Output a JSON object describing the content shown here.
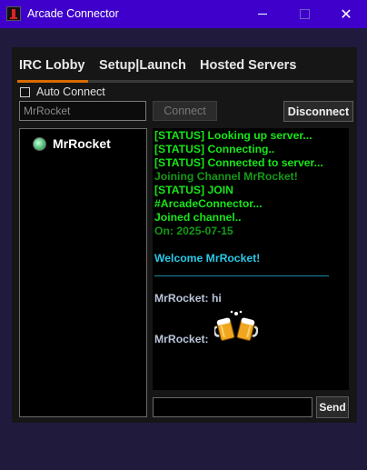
{
  "window": {
    "title": "Arcade Connector",
    "minimize_icon": "minimize-icon",
    "maximize_icon": "maximize-icon",
    "close_icon": "close-icon",
    "close_glyph": "✕"
  },
  "tabs": [
    {
      "label": "IRC Lobby",
      "active": true
    },
    {
      "label": "Setup|Launch",
      "active": false
    },
    {
      "label": "Hosted Servers",
      "active": false
    }
  ],
  "accent_color": "#d96b00",
  "auto_connect": {
    "label": "Auto Connect",
    "checked": false
  },
  "nickname_input": {
    "value": "MrRocket"
  },
  "buttons": {
    "connect": "Connect",
    "disconnect": "Disconnect",
    "send": "Send"
  },
  "users": [
    {
      "name": "MrRocket",
      "status_icon": "online-status-icon"
    }
  ],
  "chat": {
    "lines": [
      "[STATUS] Looking up server...",
      "[STATUS] Connecting..",
      "[STATUS] Connected to server...",
      "Joining Channel MrRocket!",
      "[STATUS] JOIN",
      "#ArcadeConnector...",
      "Joined channel..",
      "On: 2025-07-15"
    ],
    "welcome": "Welcome MrRocket!",
    "messages": [
      {
        "sender": "MrRocket:",
        "text": "hi"
      },
      {
        "sender": "MrRocket:",
        "text": "",
        "emoji_icon": "beer-mugs-cheers-icon"
      }
    ],
    "colors": {
      "status": "#17e617",
      "dim": "#149a14",
      "welcome": "#29c8e8",
      "message": "#b9c4d8"
    }
  },
  "message_input": {
    "value": ""
  }
}
